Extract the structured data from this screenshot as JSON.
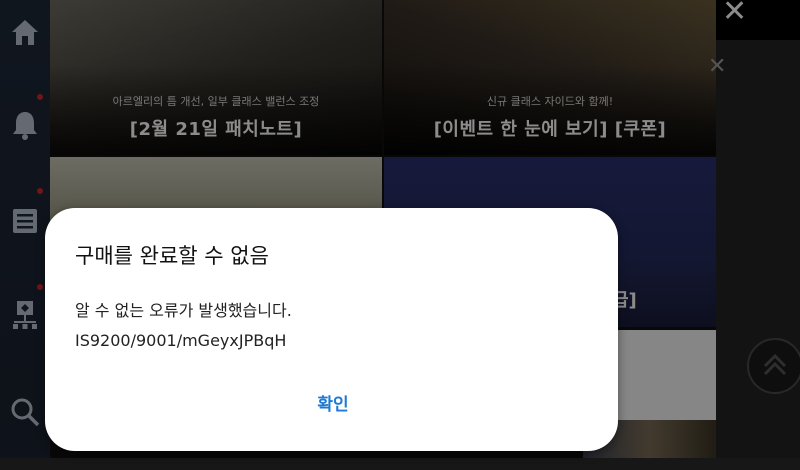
{
  "tiles": [
    {
      "subtitle": "아르엘리의 틈 개선, 일부 클래스 밸런스 조정",
      "title": "[2월 21일 패치노트]"
    },
    {
      "subtitle": "신규 클래스 자이드와 함께!",
      "title": "[이벤트 한 눈에 보기] [쿠폰]"
    }
  ],
  "peek_label": "급]",
  "dialog": {
    "title": "구매를 완료할 수 없음",
    "message_line1": "알 수 없는 오류가 발생했습니다.",
    "message_line2": "IS9200/9001/mGeyxJPBqH",
    "confirm_label": "확인"
  },
  "icons": {
    "sidebar": [
      "home-icon",
      "bell-icon",
      "list-icon",
      "sitemap-icon",
      "search-icon"
    ],
    "close": "close-icon",
    "scroll_top": "chevron-up-icon"
  },
  "colors": {
    "accent": "#1d7ad6",
    "notification": "#d0262d"
  }
}
